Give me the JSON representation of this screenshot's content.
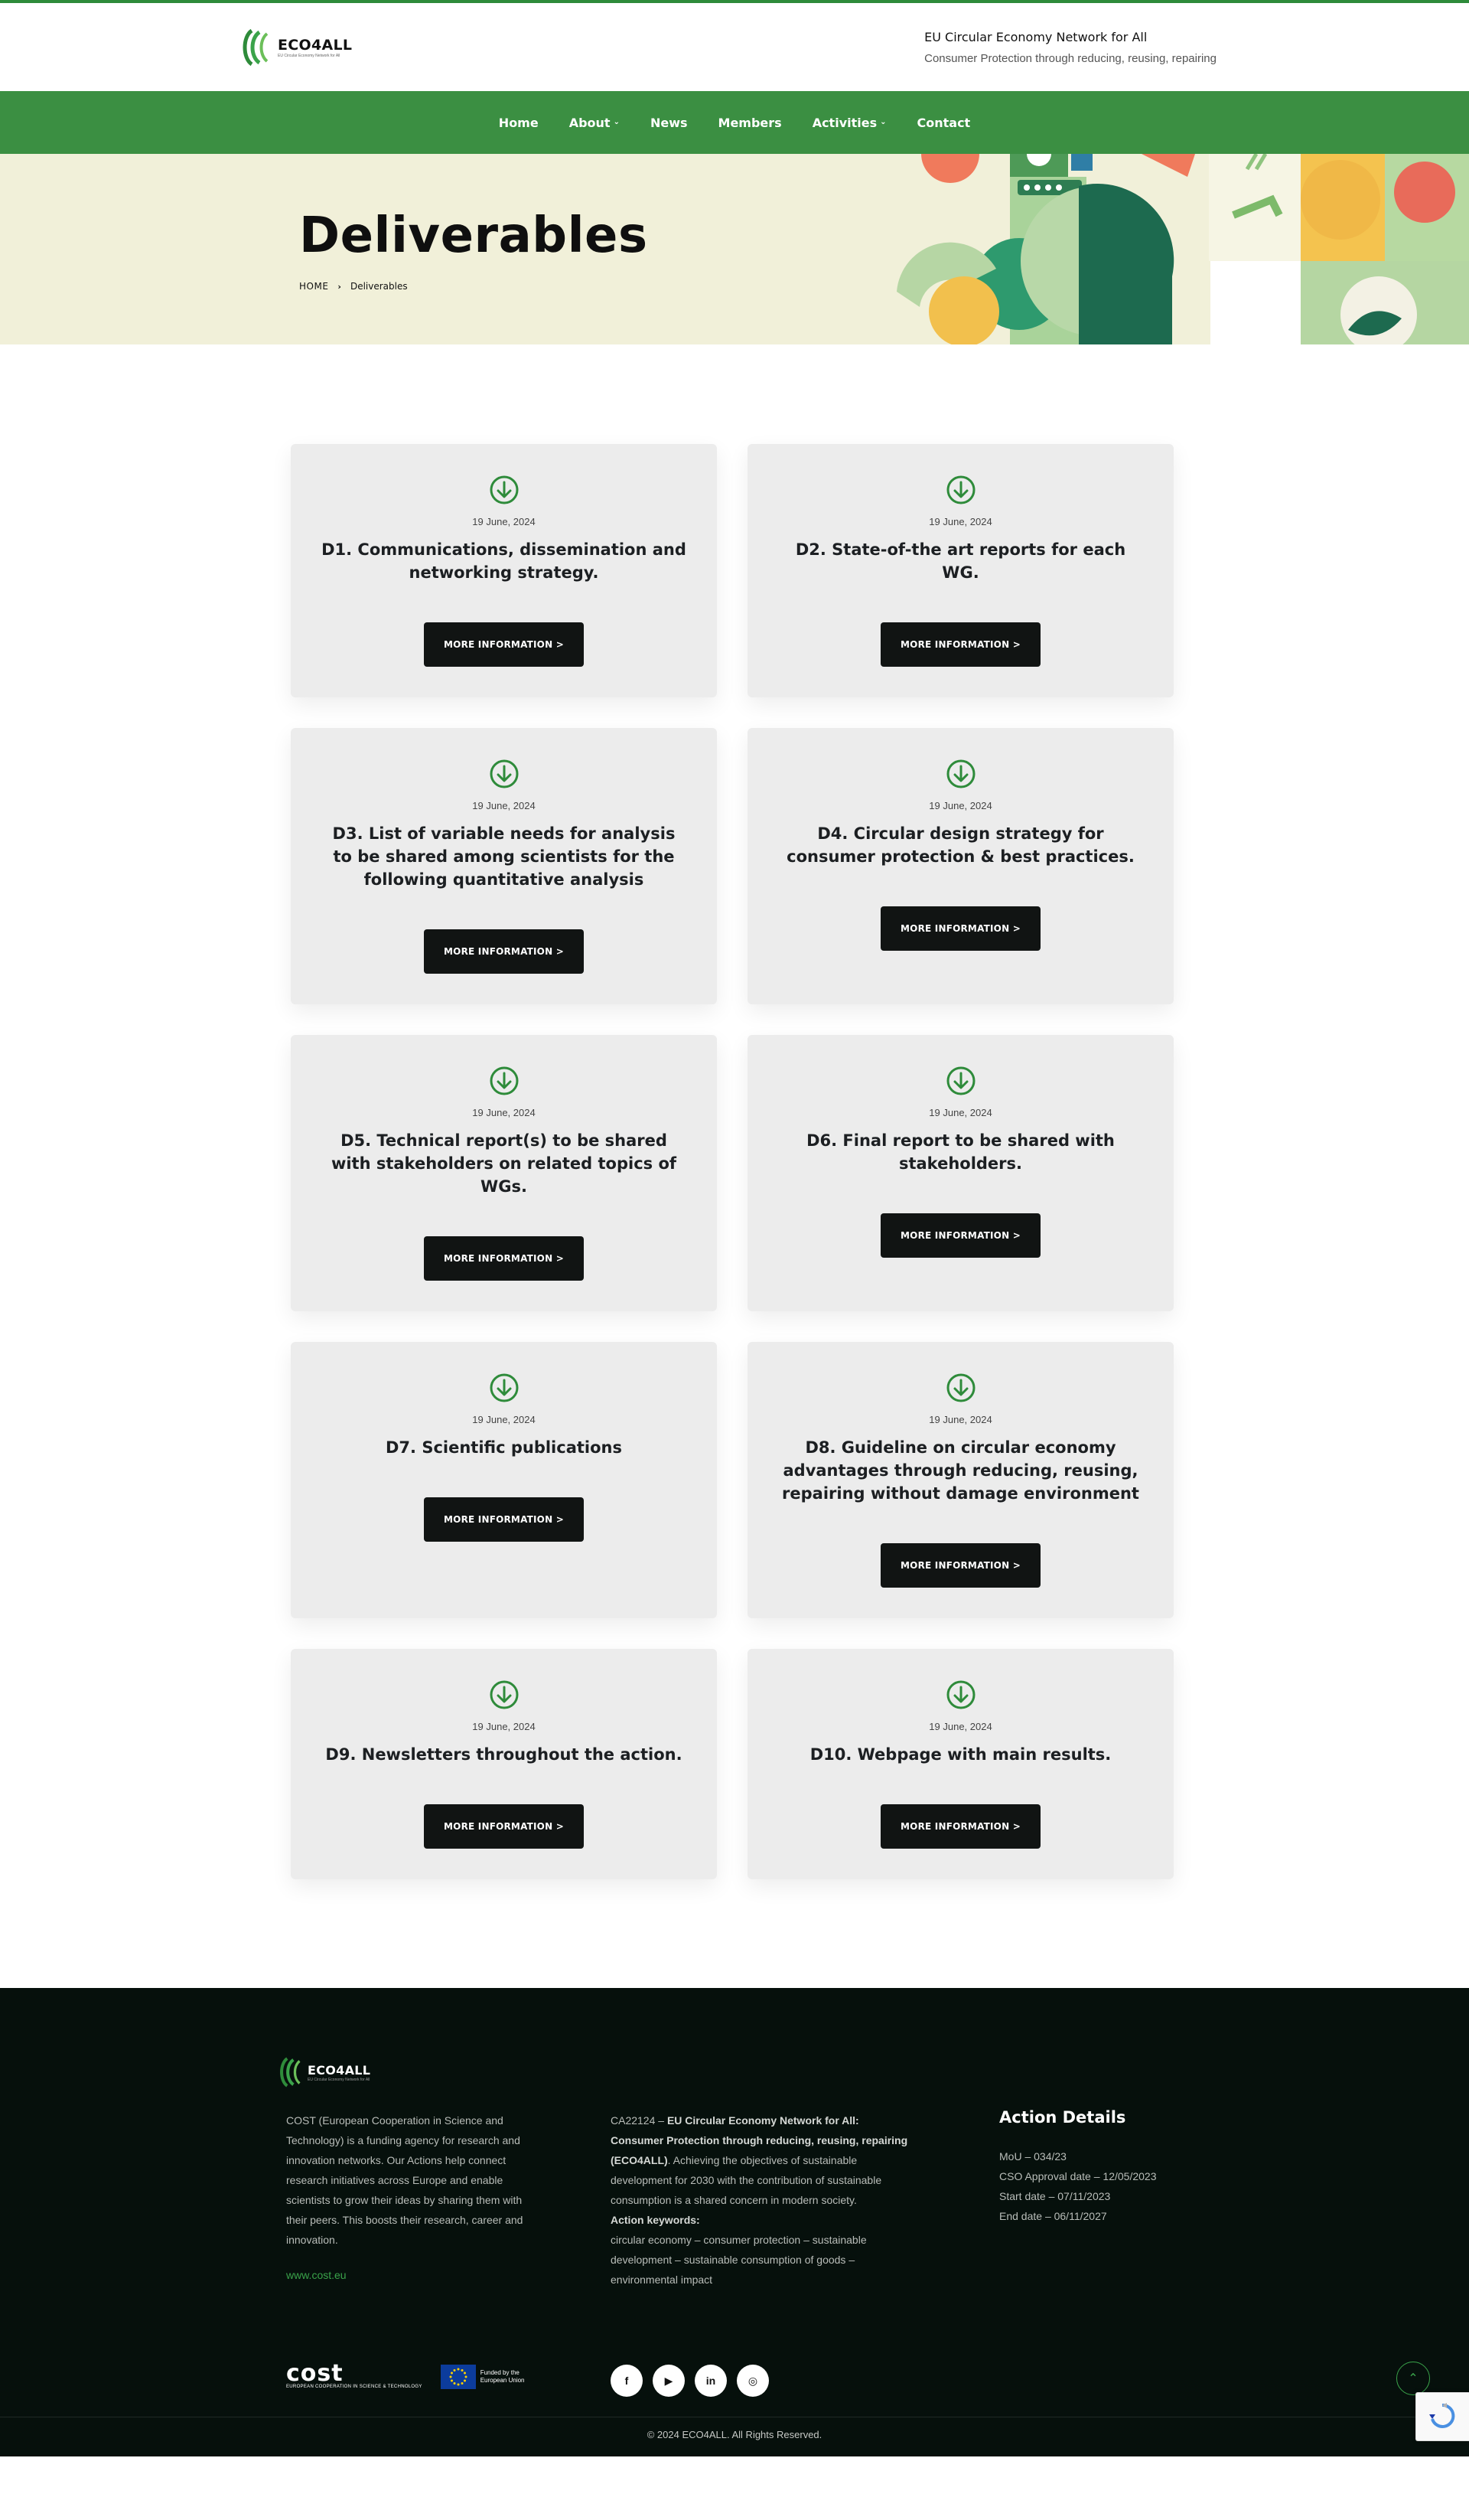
{
  "header": {
    "logo_name": "ECO4ALL",
    "logo_sub": "EU Circular Economy Network for All",
    "tagline_title": "EU Circular Economy Network for All",
    "tagline_sub": "Consumer Protection through reducing, reusing, repairing"
  },
  "nav": {
    "items": [
      {
        "label": "Home",
        "has_dropdown": false
      },
      {
        "label": "About",
        "has_dropdown": true
      },
      {
        "label": "News",
        "has_dropdown": false
      },
      {
        "label": "Members",
        "has_dropdown": false
      },
      {
        "label": "Activities",
        "has_dropdown": true
      },
      {
        "label": "Contact",
        "has_dropdown": false
      }
    ]
  },
  "hero": {
    "title": "Deliverables",
    "breadcrumb_home": "HOME",
    "breadcrumb_current": "Deliverables"
  },
  "cards": [
    {
      "date": "19 June, 2024",
      "title": "D1. Communications, dissemination and networking strategy.",
      "button": "MORE INFORMATION >"
    },
    {
      "date": "19 June, 2024",
      "title": "D2. State-of-the art reports for each WG.",
      "button": "MORE INFORMATION >"
    },
    {
      "date": "19 June, 2024",
      "title": "D3. List of variable needs for analysis to be shared among scientists for the following quantitative analysis",
      "button": "MORE INFORMATION >"
    },
    {
      "date": "19 June, 2024",
      "title": "D4. Circular design strategy for consumer protection & best practices.",
      "button": "MORE INFORMATION >"
    },
    {
      "date": "19 June, 2024",
      "title": "D5. Technical report(s) to be shared with stakeholders on related topics of WGs.",
      "button": "MORE INFORMATION >"
    },
    {
      "date": "19 June, 2024",
      "title": "D6. Final report to be shared with stakeholders.",
      "button": "MORE INFORMATION >"
    },
    {
      "date": "19 June, 2024",
      "title": "D7. Scientific publications",
      "button": "MORE INFORMATION >"
    },
    {
      "date": "19 June, 2024",
      "title": "D8. Guideline on circular economy advantages through reducing, reusing, repairing without damage environment",
      "button": "MORE INFORMATION >"
    },
    {
      "date": "19 June, 2024",
      "title": "D9. Newsletters throughout the action.",
      "button": "MORE INFORMATION >"
    },
    {
      "date": "19 June, 2024",
      "title": "D10. Webpage with main results.",
      "button": "MORE INFORMATION >"
    }
  ],
  "footer": {
    "logo_name": "ECO4ALL",
    "logo_sub": "EU Circular Economy Network for All",
    "about_text": "COST (European Cooperation in Science and Technology) is a funding agency for research and innovation networks. Our Actions help connect research initiatives across Europe and enable scientists to grow their ideas by sharing them with their peers. This boosts their research, career and innovation.",
    "link": "www.cost.eu",
    "action_code": "CA22124 – ",
    "action_title": "EU Circular Economy Network for All: Consumer Protection through reducing, reusing, repairing (ECO4ALL)",
    "action_text": ". Achieving the objectives of sustainable development for 2030 with the contribution of sustainable consumption is a shared concern in modern society.",
    "keywords_label": "Action keywords:",
    "keywords": "circular economy – consumer protection – sustainable development – sustainable consumption of goods – environmental impact",
    "details_title": "Action Details",
    "details": [
      "MoU – 034/23",
      "CSO Approval date – 12/05/2023",
      "Start date – 07/11/2023",
      "End date – 06/11/2027"
    ],
    "cost_word": "cost",
    "cost_sub": "EUROPEAN COOPERATION IN SCIENCE & TECHNOLOGY",
    "eu_text": "Funded by the European Union",
    "socials": [
      {
        "icon": "facebook-icon",
        "glyph": "f"
      },
      {
        "icon": "youtube-icon",
        "glyph": "▶"
      },
      {
        "icon": "linkedin-icon",
        "glyph": "in"
      },
      {
        "icon": "instagram-icon",
        "glyph": "◎"
      }
    ],
    "copyright": "© 2024 ECO4ALL. All Rights Reserved."
  },
  "colors": {
    "brand_green": "#3b8f42",
    "hero_bg": "#f1f0d9",
    "card_bg": "#ececec",
    "button_bg": "#111413",
    "footer_bg": "#06100c",
    "link_green": "#3aa34a"
  }
}
